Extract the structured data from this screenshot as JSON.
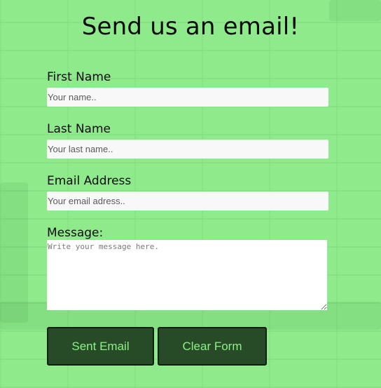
{
  "form": {
    "title": "Send us an email!",
    "first_name": {
      "label": "First Name",
      "placeholder": "Your name..",
      "value": ""
    },
    "last_name": {
      "label": "Last Name",
      "placeholder": "Your last name..",
      "value": ""
    },
    "email": {
      "label": "Email Address",
      "placeholder": "Your email adress..",
      "value": ""
    },
    "message": {
      "label": "Message:",
      "placeholder": "Write your message here.",
      "value": ""
    },
    "buttons": {
      "send_label": "Sent Email",
      "clear_label": "Clear Form"
    }
  },
  "colors": {
    "background_overlay": "#8ee98b",
    "button_background": "#264b26",
    "button_text": "#8ef08a",
    "input_background": "#f8f8f8"
  }
}
